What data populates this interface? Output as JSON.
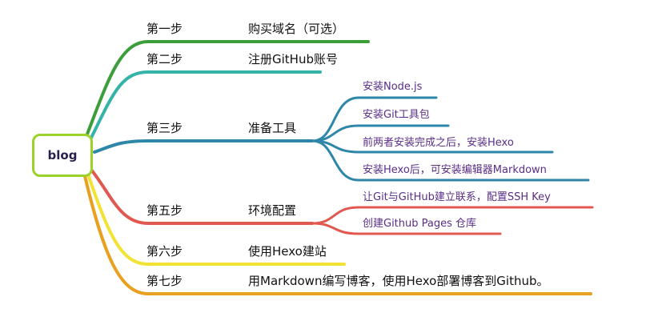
{
  "root": {
    "label": "blog",
    "border_color": "#9bd22a"
  },
  "branches": [
    {
      "step": "第一步",
      "task": "购买域名（可选）",
      "color": "#3b9e3b",
      "children": []
    },
    {
      "step": "第二步",
      "task": "注册GitHub账号",
      "color": "#36b3a7",
      "children": []
    },
    {
      "step": "第三步",
      "task": "准备工具",
      "color": "#2e86a8",
      "children": [
        "安装Node.js",
        "安装Git工具包",
        "前两者安装完成之后，安装Hexo",
        "安装Hexo后，可安装编辑器Markdown"
      ]
    },
    {
      "step": "第五步",
      "task": "环境配置",
      "color": "#e05850",
      "children": [
        "让Git与GitHub建立联系，配置SSH Key",
        "创建Github Pages 仓库"
      ]
    },
    {
      "step": "第六步",
      "task": "使用Hexo建站",
      "color": "#f2e234",
      "children": []
    },
    {
      "step": "第七步",
      "task": "用Markdown编写博客，使用Hexo部署博客到Github。",
      "color": "#e8a020",
      "children": []
    }
  ]
}
